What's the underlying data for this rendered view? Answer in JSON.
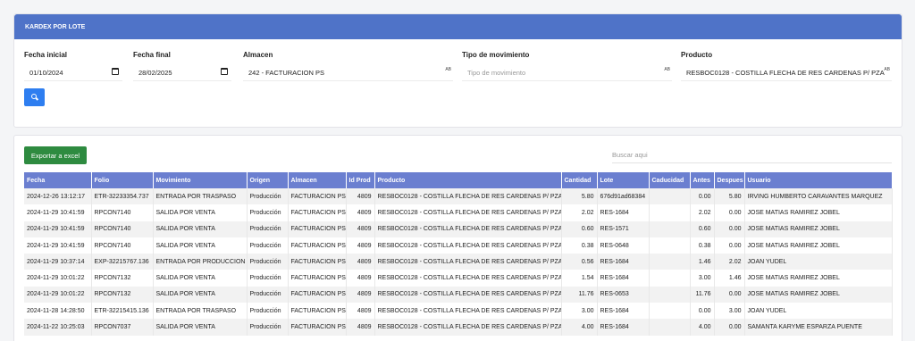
{
  "header": {
    "title": "KARDEX POR LOTE"
  },
  "filters": {
    "fecha_inicial": {
      "label": "Fecha inicial",
      "value": "01/10/2024"
    },
    "fecha_final": {
      "label": "Fecha final",
      "value": "28/02/2025"
    },
    "almacen": {
      "label": "Almacen",
      "value": "242 - FACTURACION PS"
    },
    "tipo_movimiento": {
      "label": "Tipo de movimiento",
      "placeholder": "Tipo de movimiento"
    },
    "producto": {
      "label": "Producto",
      "value": "RESBOC0128 - COSTILLA FLECHA DE RES CARDENAS P/ PZA"
    },
    "ab_glyph": "AB",
    "search_icon": "search-icon"
  },
  "toolbar": {
    "export_label": "Exportar a excel",
    "search_placeholder": "Buscar aqui"
  },
  "table": {
    "columns": [
      "Fecha",
      "Folio",
      "Movimiento",
      "Origen",
      "Almacen",
      "Id Prod",
      "Producto",
      "Cantidad",
      "Lote",
      "Caducidad",
      "Antes",
      "Despues",
      "Usuario"
    ],
    "rows": [
      [
        "2024-12-26 13:12:17",
        "ETR-32233354.737",
        "ENTRADA POR TRASPASO",
        "Producción",
        "FACTURACION PS",
        "4809",
        "RESBOC0128 - COSTILLA FLECHA DE RES CARDENAS P/ PZA",
        "5.80",
        "676d91ad68384",
        "",
        "0.00",
        "5.80",
        "IRVING HUMBERTO CARAVANTES MARQUEZ"
      ],
      [
        "2024-11-29 10:41:59",
        "RPCON7140",
        "SALIDA POR VENTA",
        "Producción",
        "FACTURACION PS",
        "4809",
        "RESBOC0128 - COSTILLA FLECHA DE RES CARDENAS P/ PZA",
        "2.02",
        "RES-1684",
        "",
        "2.02",
        "0.00",
        "JOSE MATIAS RAMIREZ JOBEL"
      ],
      [
        "2024-11-29 10:41:59",
        "RPCON7140",
        "SALIDA POR VENTA",
        "Producción",
        "FACTURACION PS",
        "4809",
        "RESBOC0128 - COSTILLA FLECHA DE RES CARDENAS P/ PZA",
        "0.60",
        "RES-1571",
        "",
        "0.60",
        "0.00",
        "JOSE MATIAS RAMIREZ JOBEL"
      ],
      [
        "2024-11-29 10:41:59",
        "RPCON7140",
        "SALIDA POR VENTA",
        "Producción",
        "FACTURACION PS",
        "4809",
        "RESBOC0128 - COSTILLA FLECHA DE RES CARDENAS P/ PZA",
        "0.38",
        "RES-0648",
        "",
        "0.38",
        "0.00",
        "JOSE MATIAS RAMIREZ JOBEL"
      ],
      [
        "2024-11-29 10:37:14",
        "EXP-32215767.136",
        "ENTRADA POR PRODUCCION",
        "Producción",
        "FACTURACION PS",
        "4809",
        "RESBOC0128 - COSTILLA FLECHA DE RES CARDENAS P/ PZA",
        "0.56",
        "RES-1684",
        "",
        "1.46",
        "2.02",
        "JOAN YUDEL"
      ],
      [
        "2024-11-29 10:01:22",
        "RPCON7132",
        "SALIDA POR VENTA",
        "Producción",
        "FACTURACION PS",
        "4809",
        "RESBOC0128 - COSTILLA FLECHA DE RES CARDENAS P/ PZA",
        "1.54",
        "RES-1684",
        "",
        "3.00",
        "1.46",
        "JOSE MATIAS RAMIREZ JOBEL"
      ],
      [
        "2024-11-29 10:01:22",
        "RPCON7132",
        "SALIDA POR VENTA",
        "Producción",
        "FACTURACION PS",
        "4809",
        "RESBOC0128 - COSTILLA FLECHA DE RES CARDENAS P/ PZA",
        "11.76",
        "RES-0653",
        "",
        "11.76",
        "0.00",
        "JOSE MATIAS RAMIREZ JOBEL"
      ],
      [
        "2024-11-28 14:28:50",
        "ETR-32215415.136",
        "ENTRADA POR TRASPASO",
        "Producción",
        "FACTURACION PS",
        "4809",
        "RESBOC0128 - COSTILLA FLECHA DE RES CARDENAS P/ PZA",
        "3.00",
        "RES-1684",
        "",
        "0.00",
        "3.00",
        "JOAN YUDEL"
      ],
      [
        "2024-11-22 10:25:03",
        "RPCON7037",
        "SALIDA POR VENTA",
        "Producción",
        "FACTURACION PS",
        "4809",
        "RESBOC0128 - COSTILLA FLECHA DE RES CARDENAS P/ PZA",
        "4.00",
        "RES-1684",
        "",
        "4.00",
        "0.00",
        "SAMANTA KARYME ESPARZA PUENTE"
      ]
    ]
  }
}
